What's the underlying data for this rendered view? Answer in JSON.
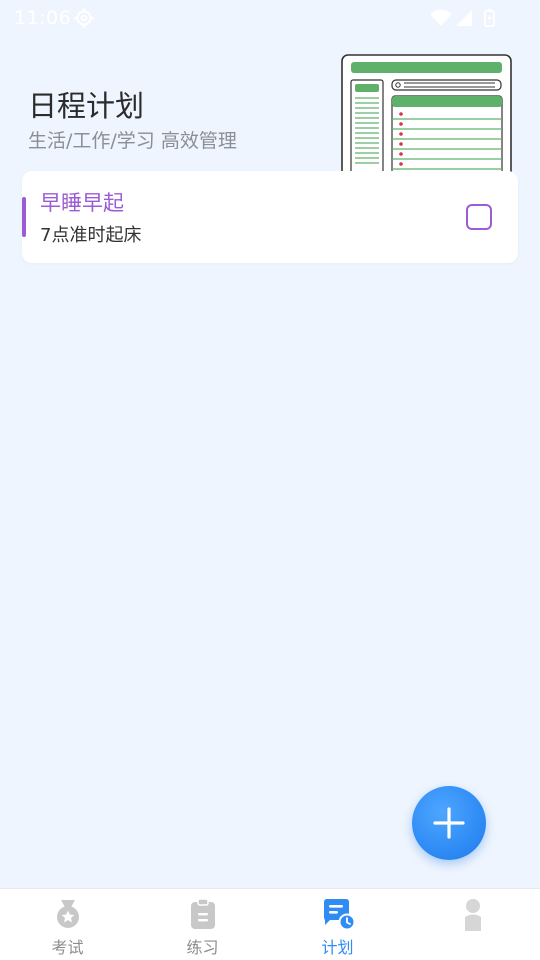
{
  "status_bar": {
    "time": "11:06"
  },
  "header": {
    "title": "日程计划",
    "subtitle": "生活/工作/学习 高效管理"
  },
  "tasks": [
    {
      "title": "早睡早起",
      "description": "7点准时起床",
      "completed": false,
      "accent_color": "#9b5cd6"
    }
  ],
  "fab": {
    "icon": "plus-icon"
  },
  "bottom_nav": {
    "items": [
      {
        "label": "考试",
        "icon": "medal-icon",
        "active": false
      },
      {
        "label": "练习",
        "icon": "clipboard-icon",
        "active": false
      },
      {
        "label": "计划",
        "icon": "schedule-icon",
        "active": true
      },
      {
        "label": "",
        "icon": "person-icon",
        "active": false
      }
    ]
  },
  "colors": {
    "background": "#eef5fe",
    "accent_blue": "#2f8cf5",
    "task_purple": "#9b5cd6",
    "illustration_green": "#5fb06a"
  }
}
